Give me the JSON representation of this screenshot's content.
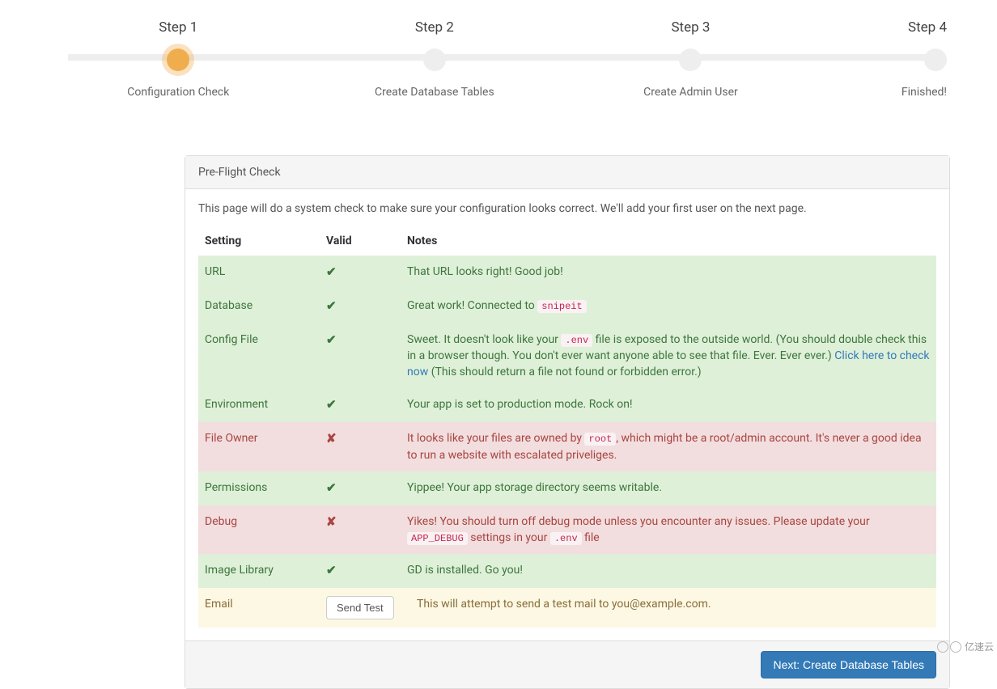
{
  "stepper": {
    "steps": [
      {
        "top": "Step 1",
        "bottom": "Configuration Check",
        "active": true
      },
      {
        "top": "Step 2",
        "bottom": "Create Database Tables",
        "active": false
      },
      {
        "top": "Step 3",
        "bottom": "Create Admin User",
        "active": false
      },
      {
        "top": "Step 4",
        "bottom": "Finished!",
        "active": false
      }
    ]
  },
  "panel": {
    "heading": "Pre-Flight Check",
    "intro": "This page will do a system check to make sure your configuration looks correct. We'll add your first user on the next page.",
    "columns": {
      "setting": "Setting",
      "valid": "Valid",
      "notes": "Notes"
    },
    "rows": {
      "url": {
        "setting": "URL",
        "status": "pass",
        "notes_plain": "That URL looks right! Good job!"
      },
      "database": {
        "setting": "Database",
        "status": "pass",
        "notes_prefix": "Great work! Connected to ",
        "code": "snipeit"
      },
      "config": {
        "setting": "Config File",
        "status": "pass",
        "part1": "Sweet. It doesn't look like your ",
        "code1": ".env",
        "part2": " file is exposed to the outside world. (You should double check this in a browser though. You don't ever want anyone able to see that file. Ever. Ever ever.) ",
        "link": "Click here to check now",
        "part3": " (This should return a file not found or forbidden error.)"
      },
      "environment": {
        "setting": "Environment",
        "status": "pass",
        "notes_plain": "Your app is set to production mode. Rock on!"
      },
      "owner": {
        "setting": "File Owner",
        "status": "fail",
        "part1": "It looks like your files are owned by ",
        "code1": "root",
        "part2": ", which might be a root/admin account. It's never a good idea to run a website with escalated priveliges."
      },
      "permissions": {
        "setting": "Permissions",
        "status": "pass",
        "notes_plain": "Yippee! Your app storage directory seems writable."
      },
      "debug": {
        "setting": "Debug",
        "status": "fail",
        "part1": "Yikes! You should turn off debug mode unless you encounter any issues. Please update your ",
        "code1": "APP_DEBUG",
        "part2": " settings in your ",
        "code2": ".env",
        "part3": " file"
      },
      "image": {
        "setting": "Image Library",
        "status": "pass",
        "notes_plain": "GD is installed. Go you!"
      },
      "email": {
        "setting": "Email",
        "status": "warn",
        "button": "Send Test",
        "notes_plain": "This will attempt to send a test mail to you@example.com."
      }
    },
    "footer_button": "Next: Create Database Tables"
  },
  "watermark": "亿速云"
}
